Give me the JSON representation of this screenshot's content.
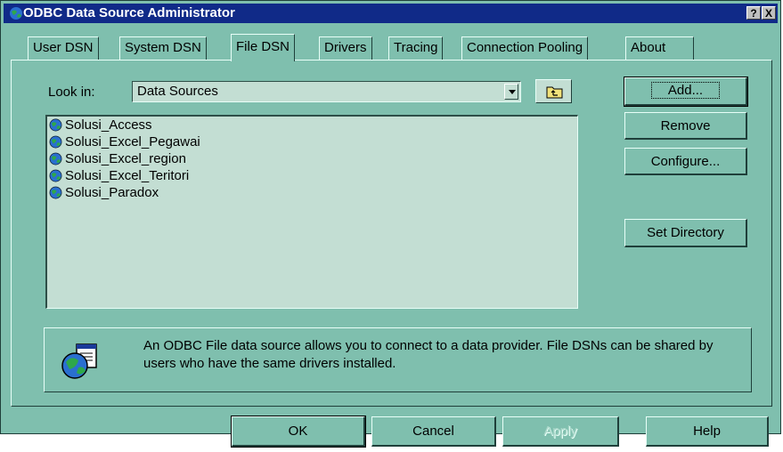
{
  "window": {
    "title": "ODBC Data Source Administrator"
  },
  "titlebar_buttons": {
    "help": "?",
    "close": "X"
  },
  "tabs": [
    {
      "label": "User DSN"
    },
    {
      "label": "System DSN"
    },
    {
      "label": "File DSN",
      "active": true
    },
    {
      "label": "Drivers"
    },
    {
      "label": "Tracing"
    },
    {
      "label": "Connection Pooling"
    },
    {
      "label": "About"
    }
  ],
  "lookin": {
    "label": "Look in:",
    "value": "Data Sources"
  },
  "file_list": [
    {
      "name": "Solusi_Access"
    },
    {
      "name": "Solusi_Excel_Pegawai"
    },
    {
      "name": "Solusi_Excel_region"
    },
    {
      "name": "Solusi_Excel_Teritori"
    },
    {
      "name": "Solusi_Paradox"
    }
  ],
  "side_buttons": {
    "add": "Add...",
    "remove": "Remove",
    "configure": "Configure...",
    "set_directory": "Set Directory"
  },
  "info": {
    "text": "An ODBC File data source allows you to connect to a data provider.  File DSNs can be shared by users who have the same drivers installed."
  },
  "footer_buttons": {
    "ok": "OK",
    "cancel": "Cancel",
    "apply": "Apply",
    "help": "Help"
  },
  "colors": {
    "dialog_bg": "#7fbfae",
    "field_bg": "#c3ded3",
    "titlebar": "#102a88"
  },
  "icons": {
    "globe": "globe-icon",
    "up_folder": "up-folder-icon",
    "info": "globe-document-icon"
  }
}
